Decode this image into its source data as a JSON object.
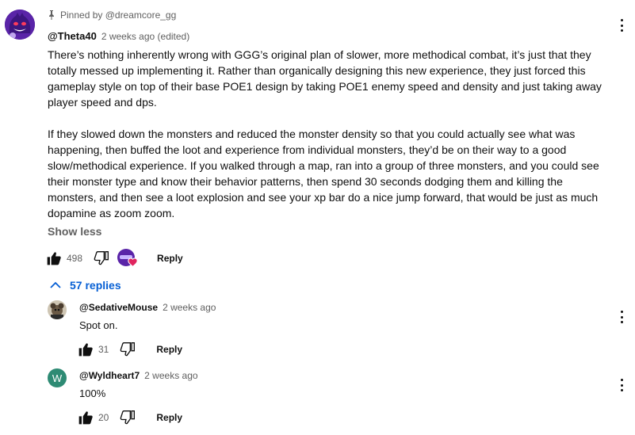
{
  "comment": {
    "pinned_text": "Pinned by @dreamcore_gg",
    "author": "@Theta40",
    "meta": "2 weeks ago (edited)",
    "paragraphs": [
      "There’s nothing inherently wrong with GGG’s original plan of slower, more methodical combat, it’s just that they totally messed up implementing it. Rather than organically designing this new experience, they just forced this gameplay style on top of their base POE1 design by taking POE1 enemy speed and density and just taking away player speed and dps.",
      "If they slowed down the monsters and reduced the monster density so that you could actually see what was happening, then buffed the loot and experience from individual monsters, they’d be on their way to a good slow/methodical experience. If you walked through a map, ran into a group of three monsters, and you could see their monster type and know their behavior patterns, then spend 30 seconds dodging them and killing the monsters, and then see a loot explosion and see your xp bar do a nice jump forward, that would be just as much dopamine as zoom zoom."
    ],
    "show_less": "Show less",
    "likes": "498",
    "reply_label": "Reply"
  },
  "replies_toggle": {
    "label": "57 replies"
  },
  "replies": [
    {
      "author": "@SedativeMouse",
      "time": "2 weeks ago",
      "text": "Spot on.",
      "likes": "31",
      "reply_label": "Reply"
    },
    {
      "author": "@Wyldheart7",
      "time": "2 weeks ago",
      "text": "100%",
      "likes": "20",
      "reply_label": "Reply",
      "avatar_letter": "W"
    }
  ],
  "colors": {
    "link_blue": "#065fd4",
    "meta_gray": "#606060",
    "avatar_teal": "#2e8b74",
    "heart_red": "#e0245e"
  },
  "icons": [
    "pin-icon",
    "thumbs-up-icon",
    "thumbs-down-icon",
    "creator-heart-icon",
    "chevron-up-icon",
    "more-vert-icon"
  ]
}
